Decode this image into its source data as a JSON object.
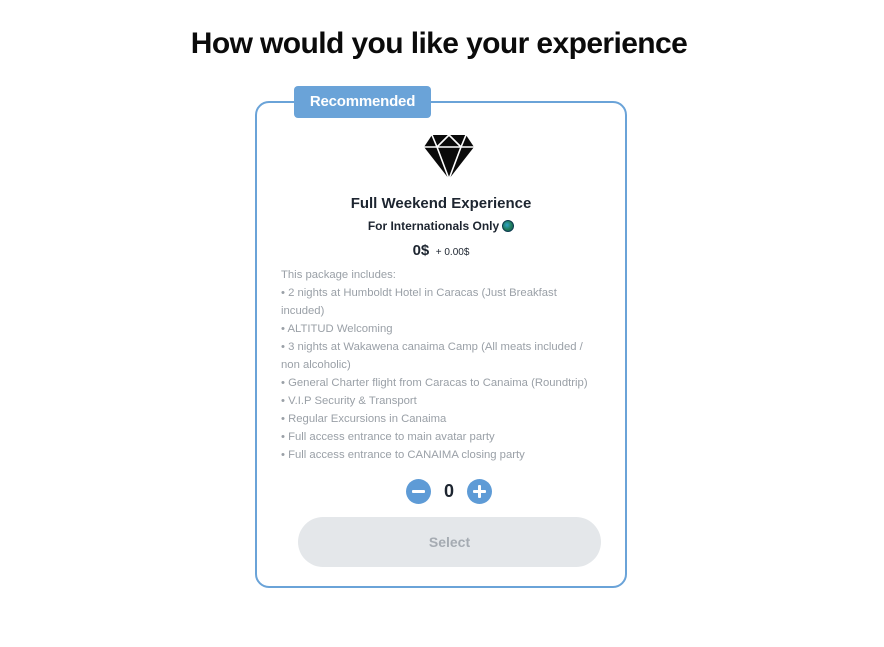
{
  "page": {
    "title": "How would you like your experience"
  },
  "card": {
    "badge": "Recommended",
    "icon": "diamond-icon",
    "title": "Full Weekend Experience",
    "subtitle": "For Internationals Only",
    "subtitle_icon": "globe-icon",
    "price": "0$",
    "price_extra": "+ 0.00$",
    "description": [
      "This package includes:",
      "• 2 nights at Humboldt Hotel in Caracas (Just Breakfast incuded)",
      "• ALTITUD Welcoming",
      "• 3 nights at Wakawena canaima Camp (All meats included / non alcoholic)",
      "• General Charter flight from Caracas to Canaima (Roundtrip)",
      "• V.I.P Security & Transport",
      "• Regular Excursions in Canaima",
      "• Full access entrance to main avatar party",
      "• Full access entrance to CANAIMA closing party"
    ],
    "quantity": "0",
    "select_label": "Select"
  },
  "colors": {
    "accent": "#6aa3d8",
    "stepper": "#5e9bd6",
    "text": "#1d2530",
    "muted": "#9aa0a7",
    "disabled_button": "#e4e7ea"
  }
}
